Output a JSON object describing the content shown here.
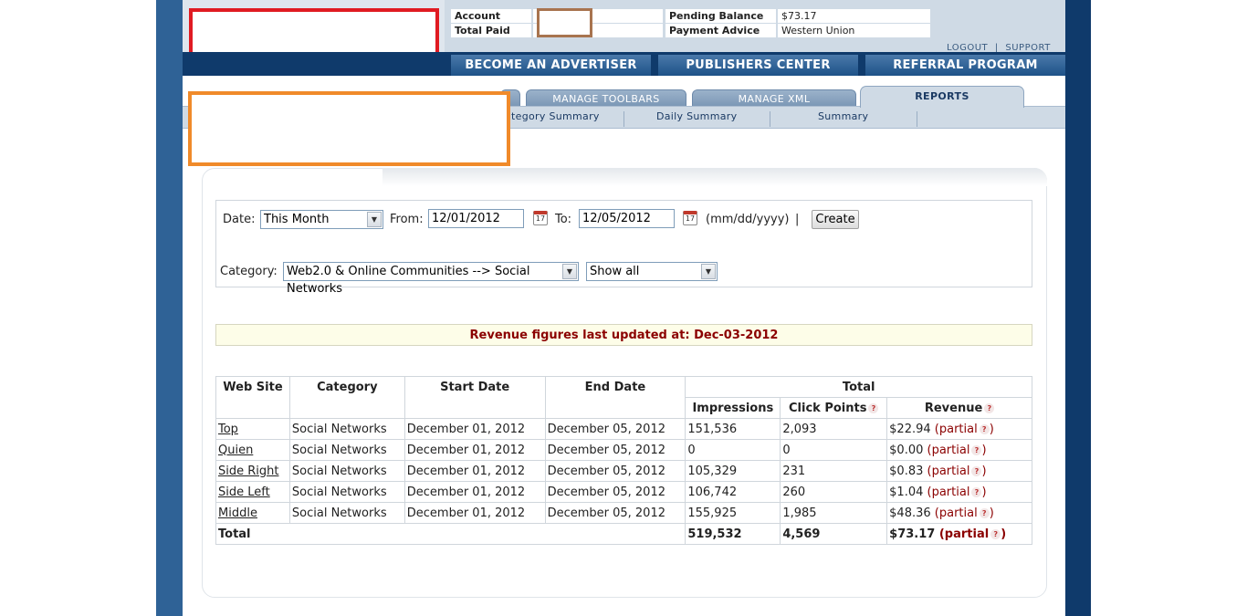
{
  "account_info": {
    "account_label": "Account",
    "account_value": "",
    "total_paid_label": "Total Paid",
    "total_paid_value": "",
    "pending_label": "Pending Balance",
    "pending_value": "$73.17",
    "payment_label": "Payment Advice",
    "payment_value": "Western Union"
  },
  "top_links": {
    "logout": "LOGOUT",
    "separator": "|",
    "support": "SUPPORT"
  },
  "main_nav": [
    "BECOME AN ADVERTISER",
    "PUBLISHERS CENTER",
    "REFERRAL PROGRAM"
  ],
  "tabs": {
    "toolbars": "MANAGE TOOLBARS",
    "xml": "MANAGE XML",
    "reports": "REPORTS"
  },
  "subnav": [
    "ategory Summary",
    "Daily Summary",
    "Summary"
  ],
  "filters": {
    "date_label": "Date:",
    "date_value": "This Month",
    "from_label": "From:",
    "from_value": "12/01/2012",
    "to_label": "To:",
    "to_value": "12/05/2012",
    "format_hint": "(mm/dd/yyyy)",
    "pipe": "|",
    "create_label": "Create",
    "category_label": "Category:",
    "category_value": "Web2.0 & Online Communities --> Social Networks",
    "show_value": "Show all",
    "calendar_glyph": "17"
  },
  "notice": "Revenue figures last updated at: Dec-03-2012",
  "table": {
    "headers": {
      "web_site": "Web Site",
      "category": "Category",
      "start_date": "Start Date",
      "end_date": "End Date",
      "total": "Total",
      "impressions": "Impressions",
      "click_points": "Click Points",
      "revenue": "Revenue"
    },
    "rows": [
      {
        "site": "Top",
        "category": "Social Networks",
        "start": "December 01, 2012",
        "end": "December 05, 2012",
        "impressions": "151,536",
        "clicks": "2,093",
        "revenue": "$22.94",
        "partial": "(partial",
        "close": ")"
      },
      {
        "site": "Quien",
        "category": "Social Networks",
        "start": "December 01, 2012",
        "end": "December 05, 2012",
        "impressions": "0",
        "clicks": "0",
        "revenue": "$0.00",
        "partial": "(partial",
        "close": ")"
      },
      {
        "site": "Side Right",
        "category": "Social Networks",
        "start": "December 01, 2012",
        "end": "December 05, 2012",
        "impressions": "105,329",
        "clicks": "231",
        "revenue": "$0.83",
        "partial": "(partial",
        "close": ")"
      },
      {
        "site": "Side Left",
        "category": "Social Networks",
        "start": "December 01, 2012",
        "end": "December 05, 2012",
        "impressions": "106,742",
        "clicks": "260",
        "revenue": "$1.04",
        "partial": "(partial",
        "close": ")"
      },
      {
        "site": "Middle",
        "category": "Social Networks",
        "start": "December 01, 2012",
        "end": "December 05, 2012",
        "impressions": "155,925",
        "clicks": "1,985",
        "revenue": "$48.36",
        "partial": "(partial",
        "close": ")"
      }
    ],
    "total_row": {
      "label": "Total",
      "impressions": "519,532",
      "clicks": "4,569",
      "revenue": "$73.17",
      "partial": "(partial",
      "close": ")"
    },
    "help_glyph": "?"
  },
  "colors": {
    "side_left": "#2f6296",
    "side_right": "#0f3a6b",
    "header_bg": "#cfdae5",
    "logo_border": "#e01b22",
    "account_border": "#a8744f",
    "orange_border": "#f08a2a",
    "notice_text": "#8b0000"
  },
  "icons": {
    "calendar": "calendar-icon",
    "help": "help-icon",
    "dropdown": "chevron-down-icon"
  }
}
